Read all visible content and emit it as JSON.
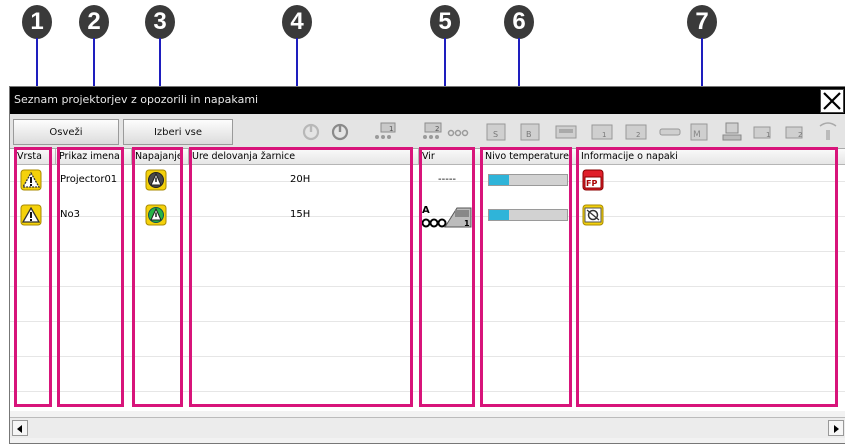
{
  "callouts": [
    "1",
    "2",
    "3",
    "4",
    "5",
    "6",
    "7"
  ],
  "window": {
    "title": "Seznam projektorjev z opozorili in napakami",
    "close_icon": "close-x-icon"
  },
  "toolbar": {
    "refresh_label": "Osveži",
    "select_all_label": "Izberi vse",
    "icons": [
      "power-on-icon",
      "power-off-icon",
      "source-computer1-icon",
      "source-computer2-icon",
      "source-video-icon",
      "source-s-video-icon",
      "source-component-icon",
      "source-dvi-icon",
      "source-hdmi-icon",
      "source-usb-icon",
      "source-lan-icon",
      "source-display1-icon",
      "source-display2-icon",
      "wireless-icon"
    ]
  },
  "table": {
    "columns": [
      "Vrsta",
      "Prikaz imena",
      "Napajanje",
      "Ure delovanja žarnice",
      "Vir",
      "Nivo temperature",
      "Informacije o napaki"
    ],
    "rows": [
      {
        "name": "Projector01",
        "lamp_hours": "20H",
        "source": "-----",
        "temperature_level": 0.25
      },
      {
        "name": "No3",
        "lamp_hours": "15H",
        "source": "",
        "temperature_level": 0.25
      }
    ]
  },
  "colors": {
    "highlight": "#d8147a",
    "callout_line": "#1e1ebe",
    "titlebar": "#000000"
  }
}
